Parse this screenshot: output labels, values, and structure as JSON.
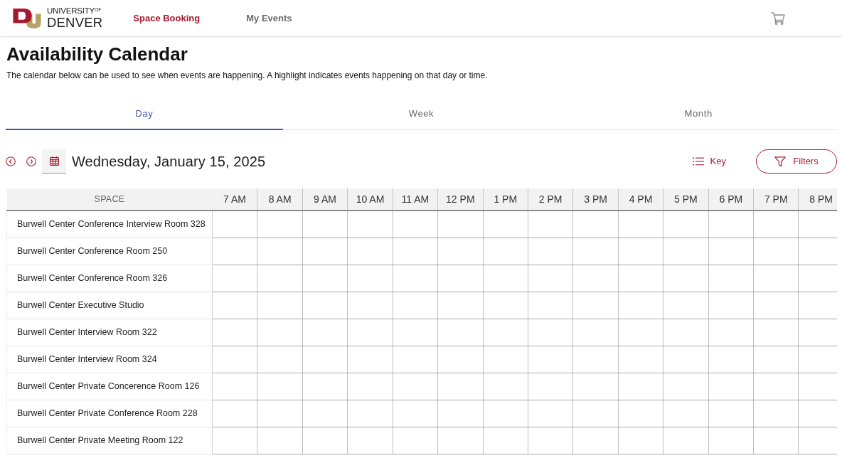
{
  "header": {
    "logo_text": [
      "UNIVERSITY$^{OF}$",
      "DENVER"
    ],
    "nav": [
      {
        "label": "Space Booking",
        "selected": true
      },
      {
        "label": "My Events",
        "selected": false
      }
    ]
  },
  "page": {
    "title": "Availability Calendar",
    "description": "The calendar below can be used to see when events are happening. A highlight indicates events happening on that day or time."
  },
  "tabs": [
    {
      "label": "Day",
      "selected": true
    },
    {
      "label": "Week",
      "selected": false
    },
    {
      "label": "Month",
      "selected": false
    }
  ],
  "toolbar": {
    "date": "Wednesday, January 15, 2025",
    "key_label": "Key",
    "filters_label": "Filters"
  },
  "table": {
    "columns": [
      "SPACE",
      "7 AM",
      "8 AM",
      "9 AM",
      "10 AM",
      "11 AM",
      "12 PM",
      "1 PM",
      "2 PM",
      "3 PM",
      "4 PM",
      "5 PM",
      "6 PM",
      "7 PM",
      "8 PM"
    ],
    "rows": [
      {
        "space": "Burwell Center Conference Interview Room 328"
      },
      {
        "space": "Burwell Center Conference Room 250"
      },
      {
        "space": "Burwell Center Conference Room 326"
      },
      {
        "space": "Burwell Center Executive Studio"
      },
      {
        "space": "Burwell Center Interview Room 322"
      },
      {
        "space": "Burwell Center Interview Room 324"
      },
      {
        "space": "Burwell Center Private Concerence Room 126"
      },
      {
        "space": "Burwell Center Private Conference Room 228"
      },
      {
        "space": "Burwell Center Private Meeting Room 122"
      }
    ]
  }
}
